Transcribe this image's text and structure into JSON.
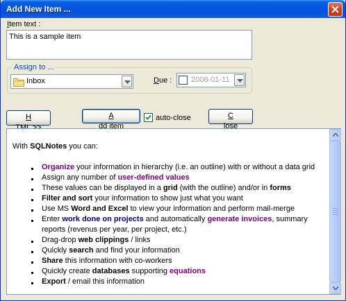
{
  "window": {
    "title": "Add New Item ..."
  },
  "item_text": {
    "label": "Item text :",
    "value": "This is a sample item"
  },
  "assign": {
    "group_label": "Assign to ...",
    "folder_value": "Inbox",
    "folder_icon": "folder-icon",
    "due_label": "Due :",
    "due_value": "2008-01-11",
    "due_checked": false
  },
  "toolbar": {
    "html_button": "HTML >>",
    "add_item_button": "Add item",
    "auto_close_label": "auto-close",
    "auto_close_checked": true,
    "close_button": "Close"
  },
  "description": {
    "intro_prefix": "With ",
    "intro_brand": "SQLNotes",
    "intro_suffix": " you can:",
    "bullets": [
      {
        "segments": [
          {
            "t": "Organize",
            "s": "purple"
          },
          {
            "t": " your information in hierarchy (i.e. an outline) with or without a data grid",
            "s": ""
          }
        ]
      },
      {
        "segments": [
          {
            "t": "Assign any number of ",
            "s": ""
          },
          {
            "t": "user-defined values",
            "s": "purple"
          }
        ]
      },
      {
        "segments": [
          {
            "t": "These values can be displayed in a ",
            "s": ""
          },
          {
            "t": "grid",
            "s": "b"
          },
          {
            "t": " (with the outline) and/or in ",
            "s": ""
          },
          {
            "t": "forms",
            "s": "b"
          }
        ]
      },
      {
        "segments": [
          {
            "t": "Filter and sort",
            "s": "b"
          },
          {
            "t": " your information to show just what you want",
            "s": ""
          }
        ]
      },
      {
        "segments": [
          {
            "t": "Use MS ",
            "s": ""
          },
          {
            "t": "Word and Excel",
            "s": "b"
          },
          {
            "t": " to view your information and perform mail-merge",
            "s": ""
          }
        ]
      },
      {
        "segments": [
          {
            "t": "Enter ",
            "s": ""
          },
          {
            "t": "work done on projects",
            "s": "blue"
          },
          {
            "t": " and automatically ",
            "s": ""
          },
          {
            "t": "generate invoices",
            "s": "purple"
          },
          {
            "t": ", summary reports (revenus per year, per project, etc.)",
            "s": ""
          }
        ]
      },
      {
        "segments": [
          {
            "t": "Drag-drop ",
            "s": ""
          },
          {
            "t": "web clippings",
            "s": "b"
          },
          {
            "t": " / links",
            "s": ""
          }
        ]
      },
      {
        "segments": [
          {
            "t": "Quickly ",
            "s": ""
          },
          {
            "t": "search",
            "s": "b"
          },
          {
            "t": " and find your information",
            "s": ""
          }
        ]
      },
      {
        "segments": [
          {
            "t": "Share",
            "s": "b"
          },
          {
            "t": " this information with co-workers",
            "s": ""
          }
        ]
      },
      {
        "segments": [
          {
            "t": "Quickly create ",
            "s": ""
          },
          {
            "t": "databases",
            "s": "b"
          },
          {
            "t": " supporting ",
            "s": ""
          },
          {
            "t": "equations",
            "s": "purple"
          }
        ]
      },
      {
        "segments": [
          {
            "t": "Export",
            "s": "b"
          },
          {
            "t": " / email this information",
            "s": ""
          }
        ]
      }
    ]
  },
  "colors": {
    "title_bar": "#0554e3",
    "purple_highlight": "#800080",
    "blue_highlight": "#00008b",
    "group_label": "#0046d5"
  }
}
